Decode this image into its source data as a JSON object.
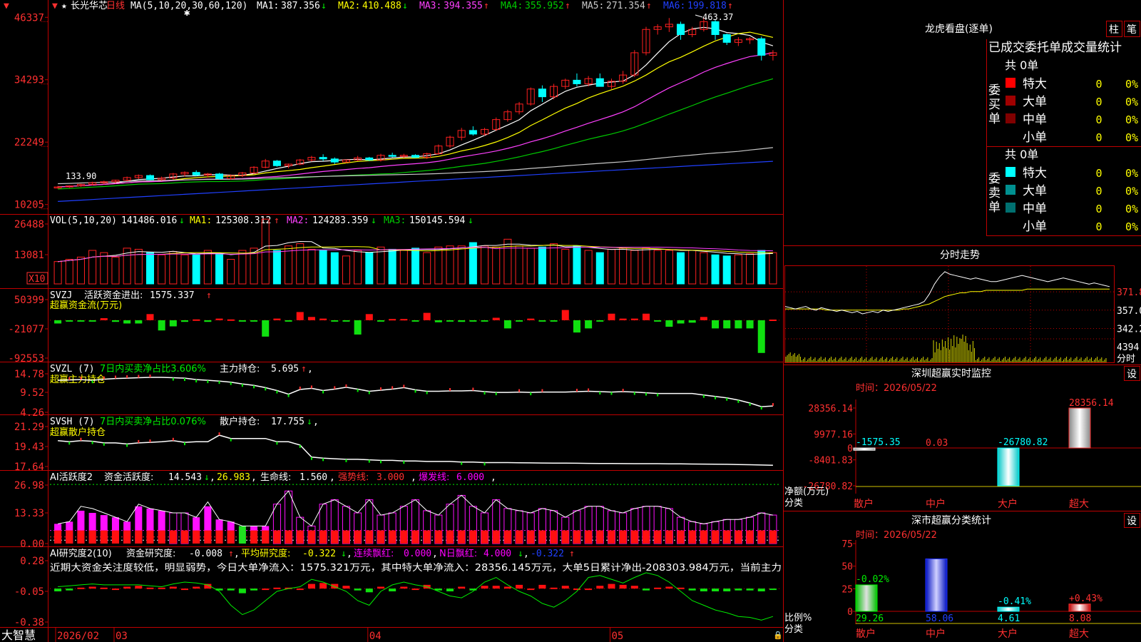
{
  "app": {
    "logo": "大智慧",
    "icon_star": "star-icon",
    "lock_icon": "lock-icon"
  },
  "colors": {
    "up": "#ff2020",
    "down": "#00ffff",
    "frame": "#c00000",
    "ma1": "#ffffff",
    "ma2": "#ffff00",
    "ma3": "#ff40ff",
    "ma4": "#00cc00",
    "ma5": "#c8c8c8",
    "ma6": "#2040ff",
    "green": "#00ee00",
    "magenta": "#ff00ff"
  },
  "kline": {
    "stock_name": "长光华芯",
    "period": "日线",
    "ma_params": "MA(5,10,20,30,60,120)",
    "ma": [
      {
        "label": "MA1:",
        "value": "387.356",
        "arrow": "↓"
      },
      {
        "label": "MA2:",
        "value": "410.488",
        "arrow": "↓"
      },
      {
        "label": "MA3:",
        "value": "394.355",
        "arrow": "↑"
      },
      {
        "label": "MA4:",
        "value": "355.952",
        "arrow": "↑"
      },
      {
        "label": "MA5:",
        "value": "271.354",
        "arrow": "↑"
      },
      {
        "label": "MA6:",
        "value": "199.818",
        "arrow": "↑"
      }
    ],
    "y_ticks": [
      "46337",
      "34293",
      "22249",
      "10205"
    ],
    "y_tick_values": [
      463.37,
      342.93,
      222.49,
      102.05
    ],
    "y_range": [
      92,
      472
    ],
    "high_label": "463.37",
    "low_label": "133.90",
    "x_labels": [
      "2026/02",
      "03",
      "04",
      "05"
    ],
    "x_label_index": [
      0,
      5,
      27,
      48
    ],
    "candles": [
      [
        135,
        138,
        133,
        136
      ],
      [
        136,
        139,
        134,
        138
      ],
      [
        138,
        142,
        136,
        141
      ],
      [
        141,
        146,
        139,
        144
      ],
      [
        144,
        148,
        141,
        146
      ],
      [
        146,
        150,
        143,
        149
      ],
      [
        149,
        156,
        147,
        154
      ],
      [
        154,
        160,
        151,
        158
      ],
      [
        158,
        160,
        149,
        150
      ],
      [
        150,
        156,
        148,
        153
      ],
      [
        153,
        163,
        150,
        161
      ],
      [
        161,
        166,
        156,
        164
      ],
      [
        164,
        168,
        157,
        159
      ],
      [
        159,
        163,
        154,
        161
      ],
      [
        161,
        163,
        150,
        152
      ],
      [
        152,
        160,
        150,
        158
      ],
      [
        158,
        165,
        155,
        163
      ],
      [
        163,
        176,
        161,
        174
      ],
      [
        174,
        190,
        172,
        186
      ],
      [
        186,
        188,
        175,
        177
      ],
      [
        177,
        181,
        172,
        180
      ],
      [
        180,
        190,
        178,
        188
      ],
      [
        188,
        196,
        185,
        193
      ],
      [
        193,
        199,
        186,
        190
      ],
      [
        190,
        193,
        180,
        184
      ],
      [
        184,
        189,
        182,
        188
      ],
      [
        188,
        196,
        186,
        192
      ],
      [
        192,
        194,
        186,
        188
      ],
      [
        188,
        200,
        185,
        197
      ],
      [
        197,
        202,
        193,
        195
      ],
      [
        195,
        200,
        192,
        197
      ],
      [
        197,
        199,
        192,
        193
      ],
      [
        193,
        202,
        190,
        200
      ],
      [
        200,
        218,
        198,
        215
      ],
      [
        215,
        235,
        211,
        232
      ],
      [
        232,
        250,
        226,
        245
      ],
      [
        245,
        253,
        235,
        238
      ],
      [
        238,
        250,
        235,
        247
      ],
      [
        247,
        270,
        244,
        266
      ],
      [
        266,
        285,
        262,
        281
      ],
      [
        281,
        300,
        276,
        296
      ],
      [
        296,
        328,
        293,
        325
      ],
      [
        325,
        332,
        300,
        310
      ],
      [
        310,
        335,
        305,
        330
      ],
      [
        330,
        345,
        325,
        342
      ],
      [
        342,
        355,
        330,
        335
      ],
      [
        335,
        350,
        330,
        345
      ],
      [
        345,
        355,
        340,
        330
      ],
      [
        330,
        345,
        325,
        340
      ],
      [
        340,
        360,
        335,
        352
      ],
      [
        352,
        400,
        348,
        395
      ],
      [
        395,
        445,
        390,
        440
      ],
      [
        440,
        450,
        430,
        445
      ],
      [
        445,
        462,
        435,
        450
      ],
      [
        450,
        455,
        420,
        430
      ],
      [
        430,
        445,
        425,
        440
      ],
      [
        440,
        463,
        436,
        455
      ],
      [
        455,
        458,
        420,
        430
      ],
      [
        430,
        432,
        410,
        415
      ],
      [
        415,
        425,
        408,
        420
      ],
      [
        420,
        425,
        412,
        422
      ],
      [
        422,
        426,
        380,
        390
      ],
      [
        390,
        400,
        380,
        395
      ]
    ]
  },
  "vol": {
    "params": "VOL(5,10,20)",
    "value": "141486.016",
    "value_arrow": "↓",
    "ma": [
      {
        "label": "MA1:",
        "value": "125308.312",
        "arrow": "↑"
      },
      {
        "label": "MA2:",
        "value": "124283.359",
        "arrow": "↓"
      },
      {
        "label": "MA3:",
        "value": "150145.594",
        "arrow": "↓"
      }
    ],
    "y_ticks": [
      "26488",
      "13081"
    ],
    "unit_badge": "X10",
    "max": 300,
    "values": [
      100,
      110,
      120,
      150,
      140,
      120,
      160,
      155,
      140,
      130,
      145,
      130,
      130,
      150,
      135,
      110,
      150,
      160,
      290,
      150,
      170,
      180,
      155,
      150,
      140,
      125,
      150,
      140,
      165,
      155,
      150,
      160,
      140,
      165,
      170,
      170,
      185,
      170,
      165,
      200,
      170,
      160,
      165,
      180,
      155,
      170,
      150,
      140,
      155,
      160,
      150,
      160,
      150,
      150,
      140,
      150,
      140,
      130,
      125,
      130,
      135,
      150,
      140
    ]
  },
  "svzj": {
    "title": "SVZJ",
    "label": "活跃资金进出:",
    "value": "1575.337",
    "arrow": "↑",
    "sub_label": "超赢资金流(万元)",
    "y_ticks": [
      "50399",
      "-21077",
      "-92553"
    ],
    "range": [
      -92553,
      50399
    ],
    "values": [
      -8000,
      -3000,
      -3000,
      -3000,
      5000,
      -4000,
      -8000,
      -8000,
      15000,
      -25000,
      -15000,
      -4000,
      2000,
      -4000,
      4000,
      2000,
      -3000,
      -3000,
      -40000,
      4000,
      -3000,
      20000,
      8000,
      4000,
      -3000,
      -3000,
      -35000,
      15000,
      -3000,
      3000,
      3000,
      -3000,
      18000,
      -5000,
      -3000,
      -4000,
      -3000,
      -3000,
      6000,
      -20000,
      -3000,
      4000,
      -3000,
      -3000,
      25000,
      -30000,
      -20000,
      -3000,
      16000,
      4000,
      4000,
      16000,
      -3000,
      -16000,
      -8000,
      -6000,
      8000,
      -20000,
      -20000,
      -20000,
      -20000,
      -80000,
      1575
    ]
  },
  "svzl": {
    "title": "SVZL (7)",
    "label1": "7日内买卖净占比3.606%",
    "label2": "主力持仓:",
    "value": "5.695",
    "arrow": "↑",
    "trail": ",",
    "sub_label": "超赢主力持仓",
    "y_ticks": [
      "14.78",
      "9.52",
      "4.26"
    ],
    "range": [
      4.26,
      14.78
    ],
    "values": [
      13.0,
      13.1,
      13.2,
      13.0,
      13.3,
      13.5,
      13.6,
      13.7,
      13.8,
      13.8,
      13.7,
      13.6,
      13.2,
      13.0,
      12.8,
      12.5,
      12.0,
      11.6,
      11.0,
      10.2,
      9.2,
      10.5,
      10.8,
      10.2,
      10.6,
      11.1,
      10.6,
      10.0,
      10.3,
      10.6,
      11.0,
      10.4,
      10.0,
      10.0,
      10.1,
      10.1,
      10.2,
      9.9,
      9.7,
      9.7,
      9.8,
      9.7,
      9.8,
      9.8,
      9.8,
      9.9,
      10.0,
      9.9,
      9.8,
      9.9,
      9.8,
      9.6,
      9.4,
      9.4,
      9.4,
      9.4,
      9.0,
      8.6,
      8.2,
      7.6,
      6.8,
      5.8,
      6.0
    ]
  },
  "svsh": {
    "title": "SVSH (7)",
    "label1": "7日内买卖净占比0.076%",
    "label2": "散户持仓:",
    "value": "17.755",
    "arrow": "↓",
    "trail": ",",
    "sub_label": "超赢散户持仓",
    "y_ticks": [
      "21.29",
      "19.43",
      "17.64"
    ],
    "range": [
      17.64,
      21.29
    ],
    "values": [
      20.0,
      19.9,
      20.0,
      19.95,
      19.8,
      19.8,
      19.7,
      19.8,
      19.85,
      19.9,
      20.0,
      19.85,
      19.9,
      19.9,
      20.5,
      20.2,
      20.2,
      20.2,
      20.2,
      19.9,
      19.9,
      19.6,
      18.5,
      18.4,
      18.35,
      18.3,
      18.3,
      18.25,
      18.2,
      18.2,
      18.15,
      18.15,
      18.1,
      18.1,
      18.1,
      18.05,
      18.05,
      18.0,
      18.0,
      18.0,
      17.98,
      17.97,
      17.96,
      17.95,
      17.95,
      17.94,
      17.93,
      17.92,
      17.92,
      17.91,
      17.9,
      17.9,
      17.9,
      17.89,
      17.88,
      17.87,
      17.86,
      17.85,
      17.84,
      17.82,
      17.8,
      17.78,
      17.76
    ]
  },
  "ai_active": {
    "title": "AI活跃度2",
    "label": "资金活跃度:",
    "value": "14.543",
    "arrow": "↓",
    "v2": "26.983",
    "label_life": "生命线:",
    "v_life": "1.560",
    "label_strong": "强势线:",
    "v_strong": "3.000",
    "label_burst": "爆发线:",
    "v_burst": "6.000",
    "y_ticks": [
      "26.98",
      "13.33",
      "0.00"
    ],
    "max": 28,
    "values": [
      9,
      10,
      15,
      14,
      13,
      12,
      10,
      17,
      16,
      15,
      14,
      14,
      12,
      17,
      11,
      10,
      8,
      8,
      8,
      7,
      8,
      9,
      12,
      13,
      14,
      13,
      15,
      14,
      13,
      14,
      14,
      15,
      14,
      13,
      16,
      15,
      17,
      14,
      15,
      13,
      16,
      15,
      16,
      13,
      12,
      15,
      14,
      13,
      13,
      14,
      13,
      13,
      14,
      13,
      11,
      10,
      9,
      10,
      10,
      10,
      10,
      12,
      11
    ],
    "lines": [
      9,
      10,
      17,
      16,
      14,
      12,
      10,
      18,
      16,
      15,
      14,
      14,
      12,
      19,
      11,
      10,
      8,
      8,
      8,
      18,
      24,
      12,
      8,
      18,
      20,
      17,
      14,
      20,
      13,
      14,
      17,
      20,
      15,
      13,
      18,
      22,
      17,
      14,
      20,
      16,
      15,
      14,
      16,
      15,
      12,
      15,
      17,
      17,
      15,
      14,
      16,
      17,
      17,
      16,
      12,
      10,
      9,
      10,
      11,
      11,
      12,
      14,
      13
    ],
    "hollow": [
      10,
      11,
      19,
      20,
      21,
      22,
      23,
      24,
      25,
      26,
      27,
      28,
      29,
      30,
      31,
      32,
      33,
      34,
      35,
      36,
      37,
      38,
      39,
      40,
      41,
      42,
      43,
      44,
      45,
      46,
      47,
      48,
      49,
      50,
      51,
      52,
      53,
      54,
      55,
      56,
      57,
      58,
      59,
      60,
      61,
      62
    ],
    "green_index": [
      16
    ]
  },
  "ai_research": {
    "title": "AI研究度2(10)",
    "label": "资金研究度:",
    "value": "-0.008",
    "arrow": "↑",
    "label_avg": "平均研究度:",
    "v_avg": "-0.322",
    "arrow_avg": "↓",
    "label_red": "连续飘红:",
    "v_red": "0.000",
    "label_n": "N日飘红:",
    "v_n": "4.000",
    "arrow_n": "↓",
    "v_last": "-0.322",
    "arrow_last": "↑",
    "comment": "近期大资金关注度较低，明显弱势，今日大单净流入：1575.321万元，其中特大单净流入：28356.145万元，大单5日累计净出-208303.984万元，当前主力",
    "y_ticks": [
      "0.28",
      "-0.05",
      "-0.38"
    ],
    "range": [
      -0.38,
      0.28
    ],
    "bars": [
      -0.03,
      -0.02,
      0.01,
      0.02,
      0.01,
      0.0,
      0.02,
      0.03,
      0.01,
      0.01,
      0.02,
      0.0,
      0.02,
      0.05,
      -0.02,
      -0.02,
      -0.05,
      -0.02,
      0.0,
      0.01,
      0.01,
      0.0,
      0.05,
      0.06,
      0.05,
      0.03,
      -0.02,
      -0.04,
      0.02,
      -0.03,
      0.02,
      0.0,
      0.04,
      -0.02,
      -0.03,
      0.02,
      -0.02,
      0.03,
      0.03,
      0.02,
      0.04,
      0.0,
      0.04,
      0.01,
      0.03,
      0.0,
      0.0,
      0.03,
      0.05,
      0.04,
      0.03,
      -0.02,
      0.01,
      0.02,
      0.01,
      -0.02,
      -0.03,
      -0.03,
      -0.03,
      -0.02,
      -0.02,
      -0.03,
      -0.01
    ],
    "line": [
      0.0,
      0.01,
      0.02,
      0.03,
      0.02,
      0.02,
      0.02,
      0.02,
      0.01,
      0.0,
      0.03,
      0.05,
      0.04,
      0.02,
      -0.05,
      -0.2,
      -0.3,
      -0.25,
      -0.15,
      -0.05,
      -0.02,
      0.0,
      0.08,
      0.05,
      0.0,
      -0.05,
      -0.15,
      -0.2,
      -0.05,
      0.02,
      0.05,
      0.02,
      0.0,
      -0.05,
      -0.1,
      -0.12,
      -0.05,
      0.05,
      0.1,
      0.02,
      -0.05,
      -0.1,
      -0.18,
      -0.22,
      -0.15,
      -0.05,
      0.1,
      0.12,
      0.08,
      0.04,
      0.1,
      0.15,
      0.12,
      0.05,
      -0.05,
      -0.15,
      -0.2,
      -0.25,
      -0.28,
      -0.32,
      -0.33,
      -0.36,
      -0.32
    ]
  },
  "dragon_tiger": {
    "title": "龙虎看盘(逐单)",
    "btn1": "柱",
    "btn2": "笔",
    "heading": "已成交委托单成交量统计",
    "buy_label": "委买单",
    "sell_label": "委卖单",
    "buy_total": "共 0单",
    "sell_total": "共 0单",
    "buy_rows": [
      {
        "name": "特大",
        "count": "0",
        "pct": "0%",
        "color": "#ff0000"
      },
      {
        "name": "大单",
        "count": "0",
        "pct": "0%",
        "color": "#a00000"
      },
      {
        "name": "中单",
        "count": "0",
        "pct": "0%",
        "color": "#800000"
      },
      {
        "name": "小单",
        "count": "0",
        "pct": "0%",
        "color": ""
      }
    ],
    "sell_rows": [
      {
        "name": "特大",
        "count": "0",
        "pct": "0%",
        "color": "#00ffff"
      },
      {
        "name": "大单",
        "count": "0",
        "pct": "0%",
        "color": "#009090"
      },
      {
        "name": "中单",
        "count": "0",
        "pct": "0%",
        "color": "#007070"
      },
      {
        "name": "小单",
        "count": "0",
        "pct": "0%",
        "color": ""
      }
    ]
  },
  "intraday": {
    "title": "分时走势",
    "y_ticks": [
      "371.8",
      "357.0",
      "342.2"
    ],
    "vol_tick": "4394",
    "vol_label": "分时",
    "range": [
      335,
      392
    ],
    "prev_close": 357,
    "price": [
      360,
      359,
      358,
      359,
      360,
      358,
      357,
      359,
      358,
      357,
      356,
      357,
      356,
      355,
      356,
      354,
      355,
      356,
      355,
      357,
      356,
      357,
      358,
      359,
      360,
      361,
      362,
      364,
      370,
      378,
      384,
      388,
      386,
      385,
      384,
      383,
      382,
      383,
      382,
      381,
      380,
      380,
      381,
      382,
      383,
      384,
      385,
      384,
      383,
      382,
      381,
      380,
      381,
      382,
      383,
      382,
      381,
      380,
      379,
      378,
      379,
      378,
      377,
      376
    ],
    "avg": [
      358,
      358,
      358,
      358,
      358,
      358,
      358,
      358,
      357,
      357,
      357,
      357,
      357,
      357,
      357,
      357,
      357,
      357,
      357,
      357,
      357,
      357,
      357,
      358,
      358,
      359,
      360,
      361,
      362,
      364,
      366,
      368,
      369,
      370,
      371,
      371,
      372,
      372,
      372,
      373,
      373,
      373,
      373,
      373,
      373,
      373,
      373,
      374,
      374,
      374,
      374,
      374,
      374,
      374,
      374,
      374,
      374,
      374,
      374,
      374,
      374,
      374,
      374,
      374
    ]
  },
  "sz_monitor": {
    "title": "深圳超赢实时监控",
    "set_btn": "设",
    "time_label": "时间：2026/05/22",
    "y_ticks": [
      "28356.14",
      "9977.16",
      "0",
      "-8401.83",
      "-26780.82"
    ],
    "range": [
      -26780.82,
      28356.14
    ],
    "y_axis_label": "净额(万元)",
    "x_axis_label": "分类",
    "categories": [
      "散户",
      "中户",
      "大户",
      "超大"
    ],
    "values": [
      -1575.35,
      0.03,
      -26780.82,
      28356.14
    ],
    "value_labels": [
      "-1575.35",
      "0.03",
      "-26780.82",
      "28356.14"
    ]
  },
  "sh_stats": {
    "title": "深市超赢分类统计",
    "set_btn": "设",
    "time_label": "时间：2026/05/22",
    "y_ticks": [
      "75",
      "50",
      "25",
      "0"
    ],
    "max": 75,
    "y_axis_label": "比例%",
    "x_axis_label": "分类",
    "categories": [
      "散户",
      "中户",
      "大户",
      "超大"
    ],
    "values": [
      29.26,
      58.06,
      4.61,
      8.08
    ],
    "value_labels": [
      "29.26",
      "58.06",
      "4.61",
      "8.08"
    ],
    "change_labels": [
      "-0.02%",
      "",
      "-0.41%",
      "+0.43%"
    ]
  }
}
